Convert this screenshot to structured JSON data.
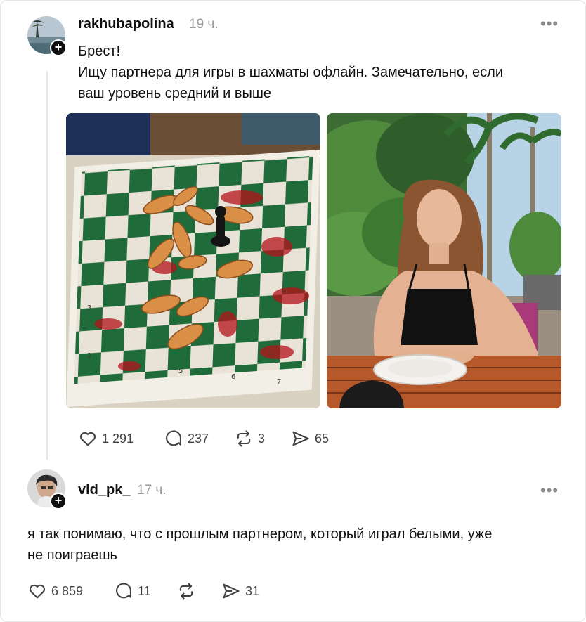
{
  "post": {
    "username": "rakhubapolina",
    "time": "19 ч.",
    "more": "•••",
    "text_line1": "Брест!",
    "text_line2": "Ищу партнера для игры в шахматы офлайн. Замечательно, если",
    "text_line3": "ваш уровень средний и выше",
    "likes": "1 291",
    "replies": "237",
    "reposts": "3",
    "shares": "65"
  },
  "reply": {
    "username": "vld_pk_",
    "time": "17 ч.",
    "more": "•••",
    "text_line1": "я так понимаю, что с прошлым партнером, который играл белыми, уже",
    "text_line2": "не поиграешь",
    "likes": "6 859",
    "replies": "11",
    "reposts": "",
    "shares": "31"
  },
  "icons": {
    "like": "heart-icon",
    "reply": "comment-icon",
    "repost": "repost-icon",
    "share": "send-icon",
    "follow": "plus-icon"
  },
  "colors": {
    "text": "#101010",
    "muted": "#999999",
    "icon": "#424242",
    "chess_green": "#1f6b3a",
    "blood_red": "#b3131b"
  }
}
